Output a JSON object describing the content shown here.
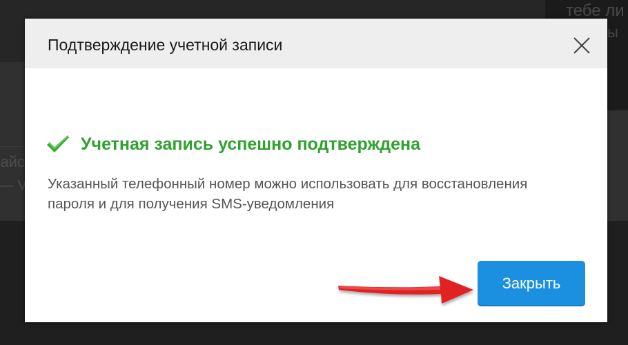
{
  "background": {
    "right_text_line1": "тебе ли",
    "right_text_line2": "ы",
    "left_text_line1": "айс",
    "left_text_line2": "— V"
  },
  "dialog": {
    "title": "Подтверждение учетной записи",
    "close_icon": "close-icon",
    "success_icon": "checkmark-icon",
    "success_message": "Учетная запись успешно подтверждена",
    "description": "Указанный телефонный номер можно использовать для восстановления пароля и для получения SMS-уведомления",
    "close_button_label": "Закрыть"
  },
  "annotation": {
    "arrow_icon": "red-arrow-icon"
  },
  "colors": {
    "success": "#2fa12f",
    "primary_button": "#1b8fe0",
    "header_background": "#eeeeee",
    "arrow": "#e02020"
  }
}
